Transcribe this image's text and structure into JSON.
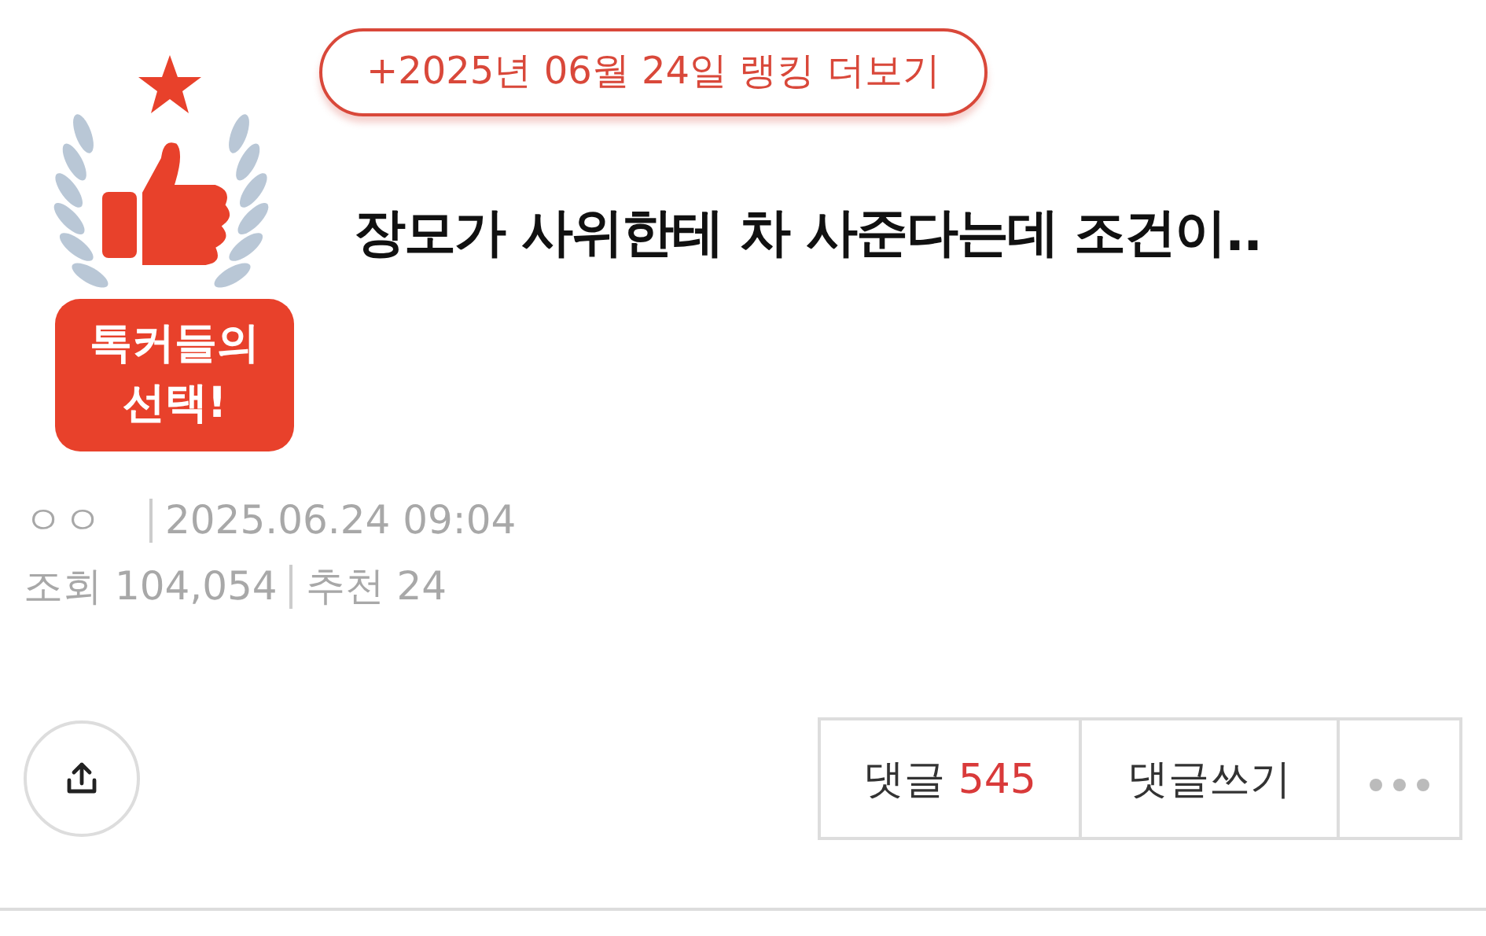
{
  "ranking_link": "+2025년 06월 24일 랭킹 더보기",
  "badge": {
    "lines": [
      "톡커들의",
      "선택!"
    ]
  },
  "title": "장모가 사위한테 차 사준다는데 조건이..",
  "meta": {
    "author": "ㅇㅇ",
    "date": "2025.06.24 09:04",
    "views_label": "조회",
    "views": "104,054",
    "likes_label": "추천",
    "likes": "24"
  },
  "actions": [
    {
      "kind": "comments",
      "label": "댓글",
      "count": "545"
    },
    {
      "kind": "write",
      "label": "댓글쓰기"
    },
    {
      "kind": "more"
    }
  ]
}
